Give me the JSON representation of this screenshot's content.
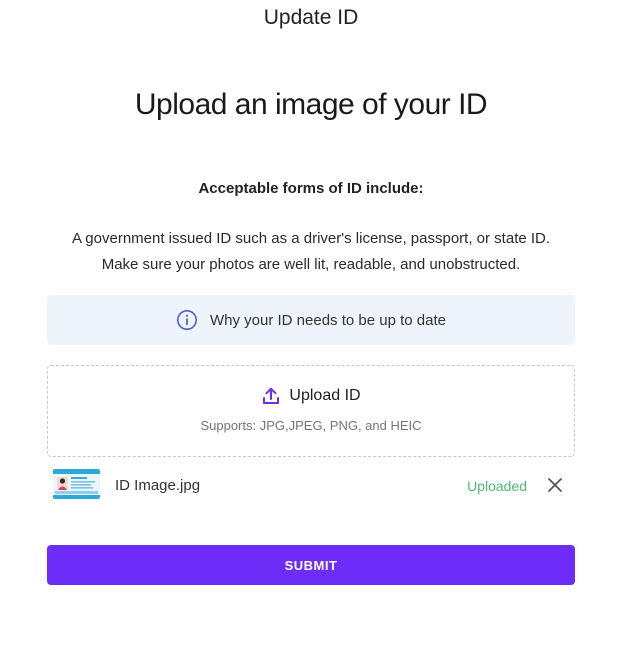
{
  "header": {
    "title": "Update ID"
  },
  "main": {
    "heading": "Upload an image of your ID",
    "forms_label": "Acceptable forms of ID include:",
    "description_line1": "A government issued ID such as a driver's license, passport, or state ID.",
    "description_line2": "Make sure your photos are well lit, readable, and unobstructed."
  },
  "info_banner": {
    "icon": "info-icon",
    "text": "Why your ID needs to be up to date"
  },
  "upload": {
    "icon": "upload-icon",
    "label": "Upload ID",
    "supports": "Supports: JPG,JPEG, PNG, and HEIC"
  },
  "file": {
    "name": "ID Image.jpg",
    "status": "Uploaded",
    "remove_icon": "close-icon"
  },
  "submit": {
    "label": "SUBMIT"
  },
  "colors": {
    "accent": "#6d2cf8",
    "status_green": "#4dbb74",
    "banner_bg": "#eff3fc"
  }
}
